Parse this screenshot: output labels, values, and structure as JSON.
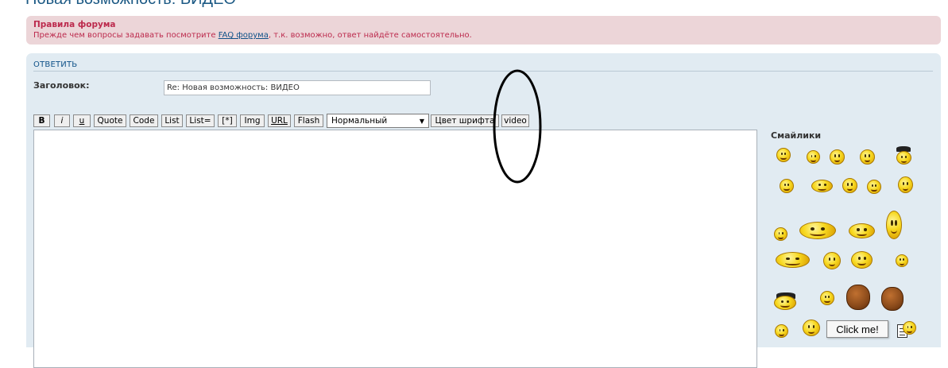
{
  "page": {
    "title": "Новая возможность: ВИДЕО"
  },
  "rules": {
    "title": "Правила форума",
    "text_before": "Прежде чем вопросы задавать посмотрите ",
    "link": "FAQ форума",
    "text_after": ", т.к. возможно, ответ найдёте самостоятельно."
  },
  "reply": {
    "heading": "ОТВЕТИТЬ",
    "subject_label": "Заголовок:",
    "subject_value": "Re: Новая возможность: ВИДЕО"
  },
  "toolbar": {
    "buttons": [
      "B",
      "i",
      "u",
      "Quote",
      "Code",
      "List",
      "List=",
      "[*]",
      "Img",
      "URL",
      "Flash",
      "Цвет шрифта",
      "video"
    ],
    "font_size_selected": "Нормальный"
  },
  "smilies": {
    "label": "Смайлики",
    "more_button": "Click me!"
  },
  "colors": {
    "title": "#1d5a85",
    "rules_bg": "#ecd5d8",
    "rules_text": "#bc2a4d",
    "link": "#105289",
    "panel_bg": "#e1ebf2",
    "smiley": "#f7d81f"
  }
}
